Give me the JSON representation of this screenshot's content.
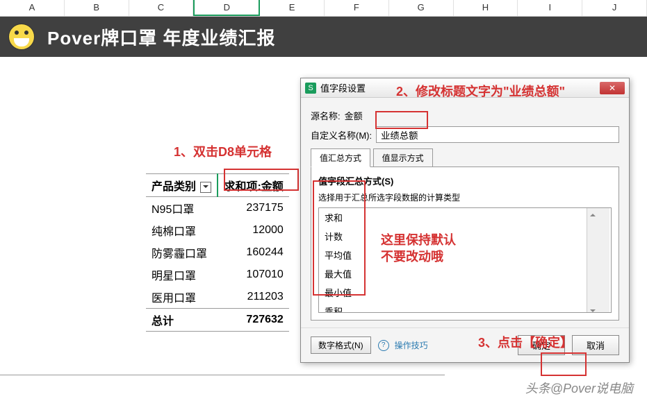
{
  "columns": [
    "A",
    "B",
    "C",
    "D",
    "E",
    "F",
    "G",
    "H",
    "I",
    "J"
  ],
  "selected_col": "D",
  "banner": {
    "title": "Pover牌口罩   年度业绩汇报"
  },
  "annotations": {
    "a1": "1、双击D8单元格",
    "a2": "2、修改标题文字为\"业绩总额\"",
    "a3": "这里保持默认",
    "a3b": "不要改动哦",
    "a4": "3、点击【确定】"
  },
  "pivot": {
    "header1": "产品类别",
    "header2": "求和项:金额",
    "rows": [
      {
        "label": "N95口罩",
        "value": "237175"
      },
      {
        "label": "纯棉口罩",
        "value": "12000"
      },
      {
        "label": "防雾霾口罩",
        "value": "160244"
      },
      {
        "label": "明星口罩",
        "value": "107010"
      },
      {
        "label": "医用口罩",
        "value": "211203"
      }
    ],
    "total_label": "总计",
    "total_value": "727632"
  },
  "dialog": {
    "title": "值字段设置",
    "source_label": "源名称:",
    "source_value": "金额",
    "custom_label": "自定义名称(M):",
    "custom_value": "业绩总额",
    "tab1": "值汇总方式",
    "tab2": "值显示方式",
    "summary_label": "值字段汇总方式(S)",
    "list_caption": "选择用于汇总所选字段数据的计算类型",
    "options": [
      "求和",
      "计数",
      "平均值",
      "最大值",
      "最小值",
      "乘积"
    ],
    "numfmt": "数字格式(N)",
    "tips": "操作技巧",
    "ok": "确定",
    "cancel": "取消"
  },
  "watermark": "头条@Pover说电脑"
}
